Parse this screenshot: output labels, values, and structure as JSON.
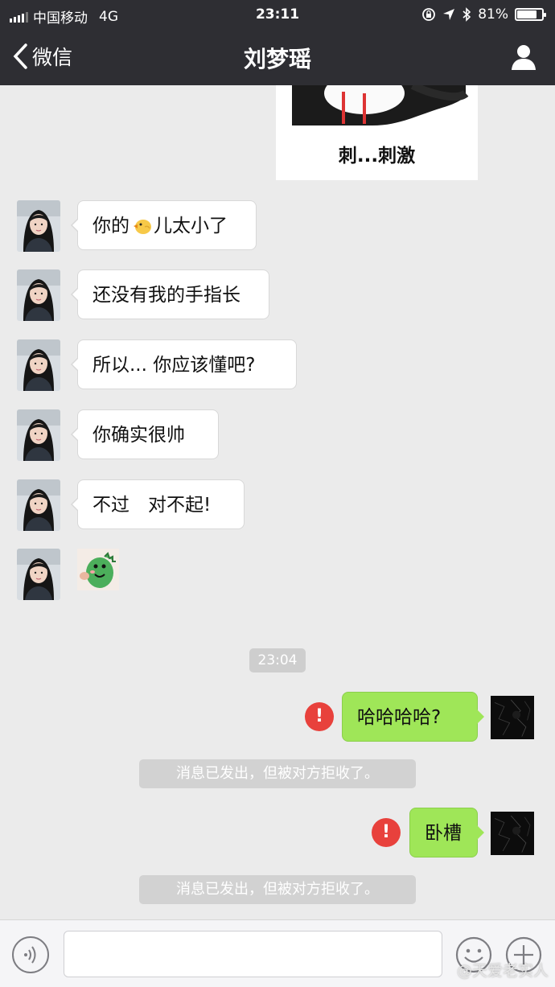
{
  "status_bar": {
    "carrier": "中国移动",
    "network": "4G",
    "time": "23:11",
    "battery": "81%",
    "battery_level": 0.81
  },
  "nav": {
    "back_label": "微信",
    "title": "刘梦瑶"
  },
  "sticker_caption": "刺...刺激",
  "incoming_messages": [
    {
      "text_before": "你的",
      "emoji": "chick-emoji",
      "text_after": "儿太小了"
    },
    {
      "text": "还没有我的手指长"
    },
    {
      "text": "所以... 你应该懂吧?"
    },
    {
      "text": "你确实很帅"
    },
    {
      "text": "不过　对不起!"
    },
    {
      "sticker": "green-dinosaur-sticker"
    }
  ],
  "timestamp": "23:04",
  "outgoing_messages": [
    {
      "text": "哈哈哈哈?",
      "error_mark": "!",
      "notice": "消息已发出，但被对方拒收了。"
    },
    {
      "text": "卧槽",
      "error_mark": "!",
      "notice": "消息已发出，但被对方拒收了。"
    }
  ],
  "input": {
    "value": "",
    "placeholder": ""
  },
  "icons": {
    "back": "chevron-left-icon",
    "profile": "person-icon",
    "voice": "voice-icon",
    "emoji": "smiley-icon",
    "more": "plus-icon"
  },
  "watermark": "@天爱老实人",
  "colors": {
    "nav_background": "#2e2e33",
    "chat_background": "#ebebeb",
    "outgoing_bubble": "#9fe658",
    "error_red": "#e8413c"
  }
}
